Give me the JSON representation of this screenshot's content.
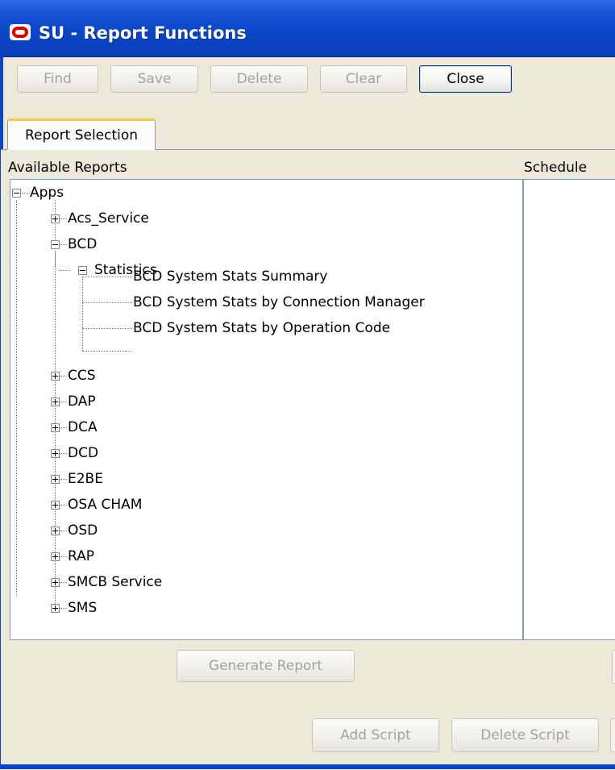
{
  "window": {
    "title": "SU - Report Functions",
    "icon": "oracle-icon"
  },
  "toolbar": {
    "find": "Find",
    "save": "Save",
    "delete": "Delete",
    "clear": "Clear",
    "close": "Close"
  },
  "tab": {
    "label": "Report Selection"
  },
  "labels": {
    "available": "Available Reports",
    "schedule": "Schedule"
  },
  "tree": {
    "root": "Apps",
    "acs": "Acs_Service",
    "bcd": "BCD",
    "statistics": "Statistics",
    "r1": "BCD System Stats Summary",
    "r2": "BCD System Stats by Connection Manager",
    "r3": "BCD System Stats by Operation Code",
    "ccs": "CCS",
    "dap": "DAP",
    "dca": "DCA",
    "dcd": "DCD",
    "e2be": "E2BE",
    "osa": "OSA CHAM",
    "osd": "OSD",
    "rap": "RAP",
    "smcb": "SMCB Service",
    "sms": "SMS"
  },
  "actions": {
    "generate": "Generate Report",
    "add_script": "Add Script",
    "delete_script": "Delete Script"
  }
}
